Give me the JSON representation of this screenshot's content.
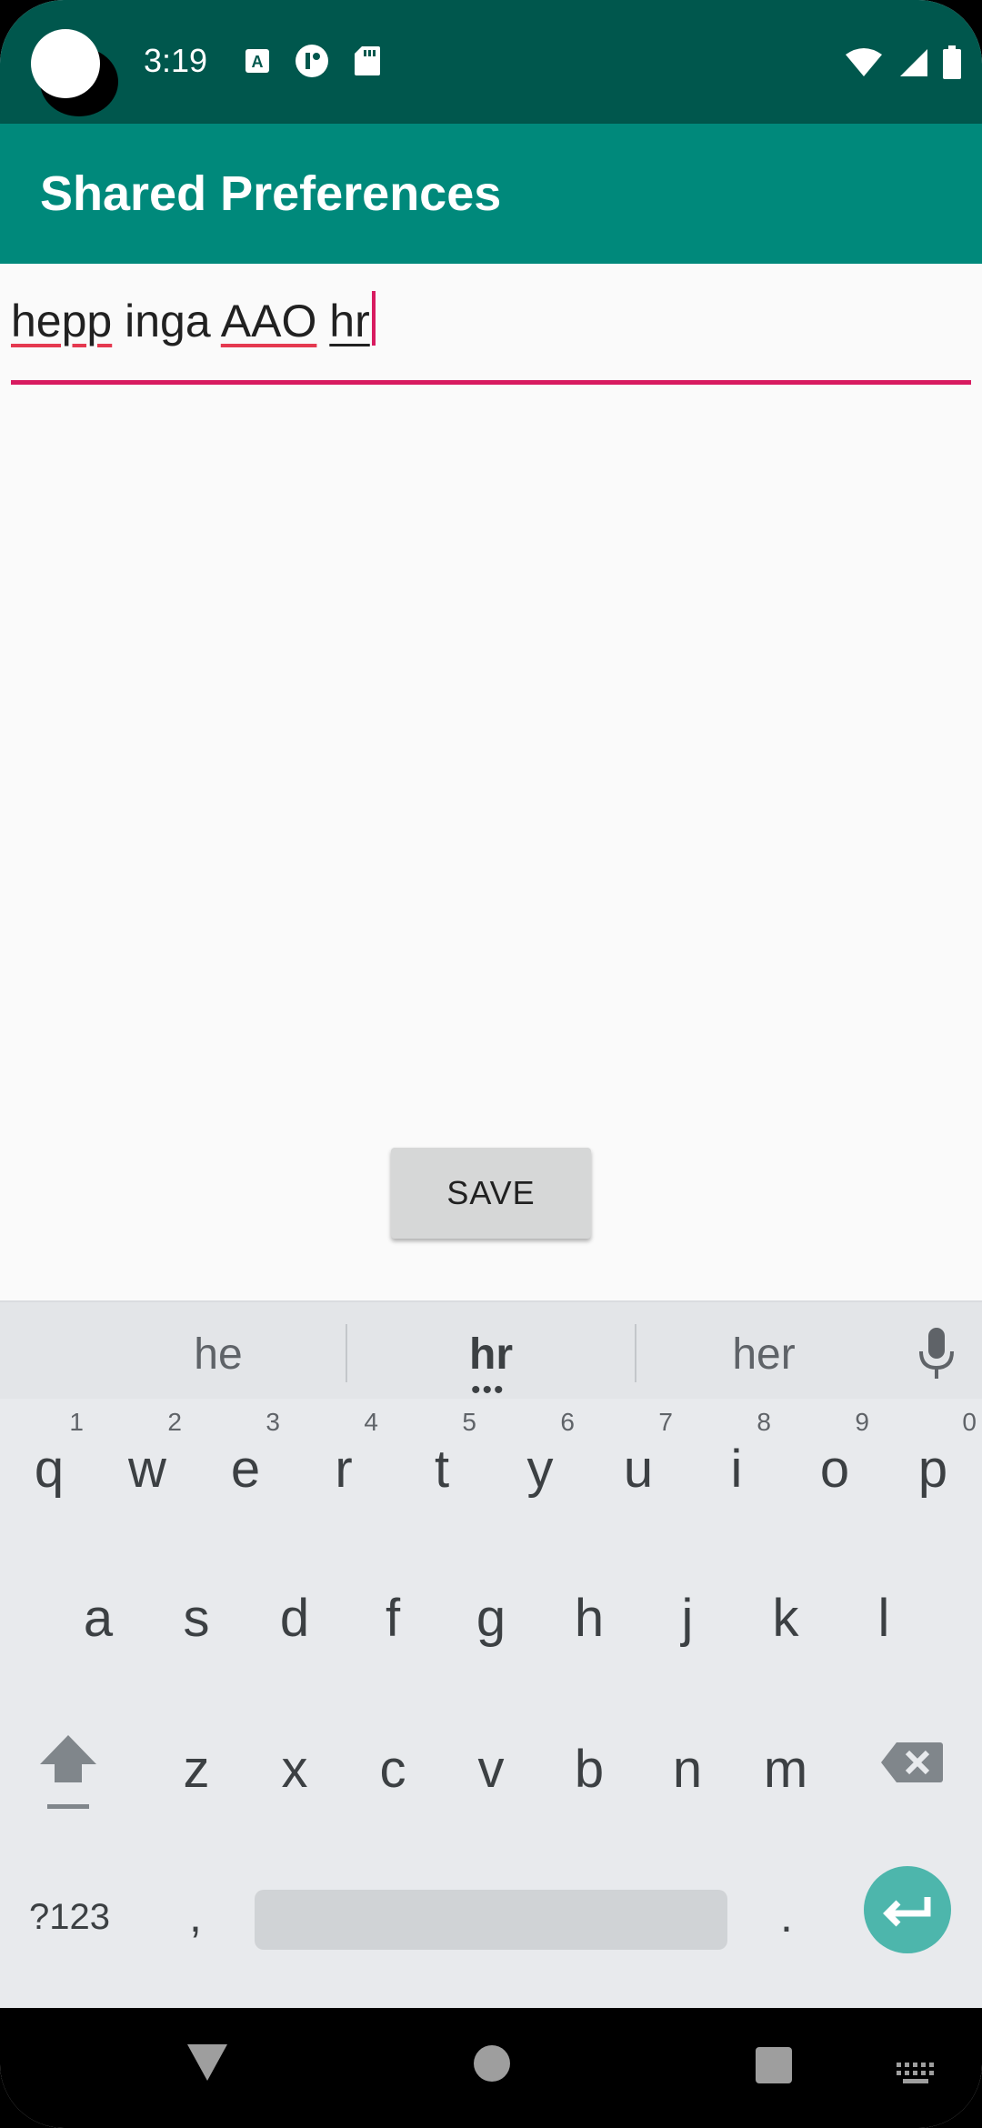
{
  "status_bar": {
    "time": "3:19",
    "icons_left": [
      "font-a-icon",
      "notification-icon",
      "sd-card-icon"
    ],
    "icons_right": [
      "wifi-icon",
      "signal-icon",
      "battery-icon"
    ]
  },
  "app_bar": {
    "title": "Shared Preferences"
  },
  "edit_text": {
    "words": [
      "hepp",
      " inga ",
      "AAO",
      " ",
      "hr"
    ],
    "accent_color": "#d81b60"
  },
  "save_button": {
    "label": "SAVE"
  },
  "keyboard": {
    "suggestions": [
      "he",
      "hr",
      "her"
    ],
    "row1": [
      {
        "ch": "q",
        "num": "1"
      },
      {
        "ch": "w",
        "num": "2"
      },
      {
        "ch": "e",
        "num": "3"
      },
      {
        "ch": "r",
        "num": "4"
      },
      {
        "ch": "t",
        "num": "5"
      },
      {
        "ch": "y",
        "num": "6"
      },
      {
        "ch": "u",
        "num": "7"
      },
      {
        "ch": "i",
        "num": "8"
      },
      {
        "ch": "o",
        "num": "9"
      },
      {
        "ch": "p",
        "num": "0"
      }
    ],
    "row2": [
      "a",
      "s",
      "d",
      "f",
      "g",
      "h",
      "j",
      "k",
      "l"
    ],
    "row3": [
      "z",
      "x",
      "c",
      "v",
      "b",
      "n",
      "m"
    ],
    "symbols_key": "?123",
    "comma_key": ",",
    "period_key": ".",
    "enter_color": "#4db6ac"
  },
  "colors": {
    "status_bar": "#00574d",
    "app_bar": "#00897b",
    "accent": "#d81b60"
  }
}
